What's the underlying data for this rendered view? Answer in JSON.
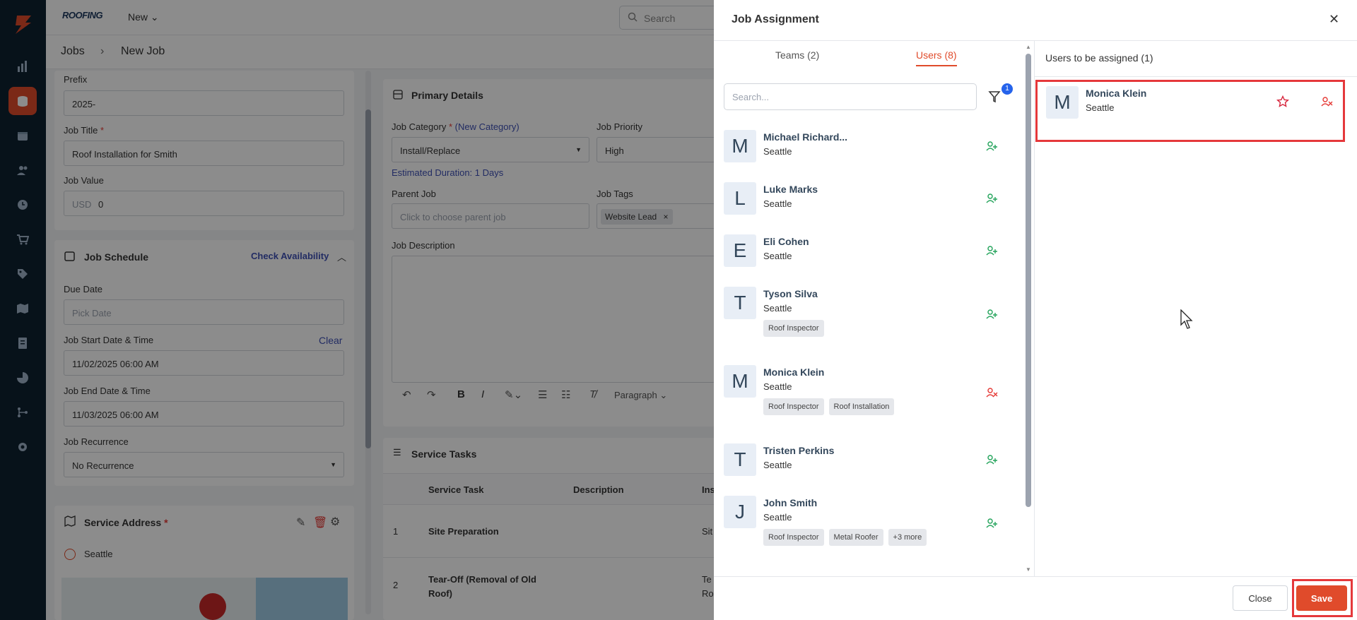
{
  "app": {
    "brand": "ROOFING",
    "new_label": "New",
    "search_placeholder": "Search"
  },
  "breadcrumb": {
    "root": "Jobs",
    "separator": "›",
    "current": "New Job"
  },
  "job_form": {
    "prefix_label": "Prefix",
    "prefix_value": "2025-",
    "title_label": "Job Title",
    "title_value": "Roof Installation for Smith",
    "value_label": "Job Value",
    "value_currency": "USD",
    "value_amount": "0",
    "required_mark": "*"
  },
  "schedule": {
    "title": "Job Schedule",
    "check_availability": "Check Availability",
    "due_label": "Due Date",
    "due_placeholder": "Pick Date",
    "start_label": "Job Start Date & Time",
    "clear": "Clear",
    "start_value": "11/02/2025 06:00 AM",
    "end_label": "Job End Date & Time",
    "end_value": "11/03/2025 06:00 AM",
    "recurrence_label": "Job Recurrence",
    "recurrence_value": "No Recurrence"
  },
  "service_address": {
    "title": "Service Address",
    "city": "Seattle"
  },
  "primary": {
    "title": "Primary Details",
    "category_label": "Job Category",
    "new_category": "(New Category)",
    "category_value": "Install/Replace",
    "duration": "Estimated Duration: 1 Days",
    "priority_label": "Job Priority",
    "priority_value": "High",
    "parent_label": "Parent Job",
    "parent_placeholder": "Click to choose parent job",
    "tags_label": "Job Tags",
    "tag_value": "Website Lead",
    "description_label": "Job Description",
    "paragraph": "Paragraph"
  },
  "service_tasks": {
    "title": "Service Tasks",
    "columns": [
      "Service Task",
      "Description",
      "Ins"
    ],
    "rows": [
      {
        "num": "1",
        "task": "Site Preparation",
        "extra": "Sit"
      },
      {
        "num": "2",
        "task": "Tear-Off (Removal of Old Roof)",
        "extra": "Te Ro"
      }
    ]
  },
  "modal": {
    "title": "Job Assignment",
    "tabs": [
      "Teams (2)",
      "Users (8)"
    ],
    "search_placeholder": "Search...",
    "filter_count": "1",
    "users": [
      {
        "initial": "M",
        "name": "Michael Richard...",
        "location": "Seattle",
        "tags": [],
        "assigned": false
      },
      {
        "initial": "L",
        "name": "Luke Marks",
        "location": "Seattle",
        "tags": [],
        "assigned": false
      },
      {
        "initial": "E",
        "name": "Eli Cohen",
        "location": "Seattle",
        "tags": [],
        "assigned": false
      },
      {
        "initial": "T",
        "name": "Tyson Silva",
        "location": "Seattle",
        "tags": [
          "Roof Inspector"
        ],
        "assigned": false
      },
      {
        "initial": "M",
        "name": "Monica Klein",
        "location": "Seattle",
        "tags": [
          "Roof Inspector",
          "Roof Installation"
        ],
        "assigned": true
      },
      {
        "initial": "T",
        "name": "Tristen Perkins",
        "location": "Seattle",
        "tags": [],
        "assigned": false
      },
      {
        "initial": "J",
        "name": "John Smith",
        "location": "Seattle",
        "tags": [
          "Roof Inspector",
          "Metal Roofer",
          "+3 more"
        ],
        "assigned": false
      }
    ],
    "assigned_header": "Users to be assigned (1)",
    "assigned": {
      "initial": "M",
      "name": "Monica Klein",
      "location": "Seattle"
    },
    "close_label": "Close",
    "save_label": "Save"
  },
  "colors": {
    "accent": "#e04b2b",
    "sidebar": "#0e2231",
    "highlight": "#e5383b",
    "add_icon": "#22a35a",
    "remove_icon": "#e53935"
  }
}
